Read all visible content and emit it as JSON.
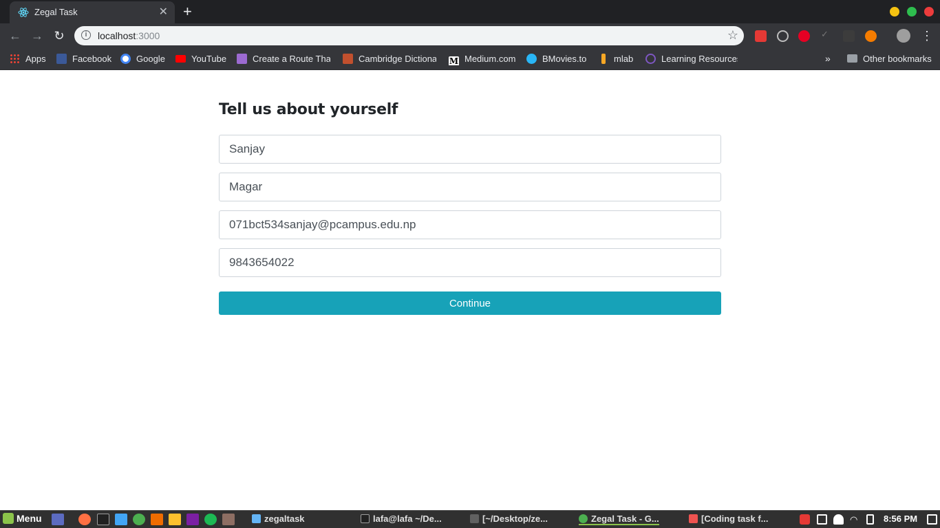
{
  "browser": {
    "tab": {
      "title": "Zegal Task",
      "favicon": "react-icon"
    },
    "new_tab_label": "+",
    "address": {
      "host": "localhost",
      "port": ":3000"
    },
    "window_controls": {
      "minimize_color": "#f5c211",
      "maximize_color": "#2ebd4e",
      "close_color": "#ed3c3c"
    }
  },
  "bookmarks": {
    "items": [
      {
        "label": "Apps",
        "icon": "apps-grid-icon"
      },
      {
        "label": "Facebook",
        "icon": "facebook-icon"
      },
      {
        "label": "Google",
        "icon": "google-icon"
      },
      {
        "label": "YouTube",
        "icon": "youtube-icon"
      },
      {
        "label": "Create a Route That",
        "icon": "cloud-icon"
      },
      {
        "label": "Cambridge Dictiona",
        "icon": "cambridge-icon"
      },
      {
        "label": "Medium.com",
        "icon": "medium-icon"
      },
      {
        "label": "BMovies.to",
        "icon": "play-icon"
      },
      {
        "label": "mlab",
        "icon": "mlab-icon"
      },
      {
        "label": "Learning Resources",
        "icon": "learning-icon"
      }
    ],
    "overflow": "»",
    "other": "Other bookmarks"
  },
  "form": {
    "title": "Tell us about yourself",
    "first_name": "Sanjay",
    "last_name": "Magar",
    "email": "071bct534sanjay@pcampus.edu.np",
    "phone": "9843654022",
    "submit_label": "Continue",
    "accent": "#17a2b8"
  },
  "taskbar": {
    "menu_label": "Menu",
    "windows": [
      {
        "label": "zegaltask",
        "icon": "folder-icon"
      },
      {
        "label": "lafa@lafa ~/De...",
        "icon": "terminal-icon"
      },
      {
        "label": "[~/Desktop/ze...",
        "icon": "sublime-icon"
      },
      {
        "label": "Zegal Task - G...",
        "icon": "chrome-icon",
        "active": true
      },
      {
        "label": "[Coding task f...",
        "icon": "image-icon"
      }
    ],
    "clock": "8:56 PM"
  }
}
